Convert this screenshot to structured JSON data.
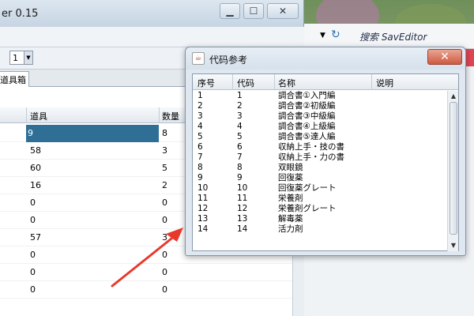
{
  "main_window": {
    "title": "er 0.15",
    "spinner_value": "1",
    "tab_label": "道具箱",
    "columns": [
      "道具",
      "数量"
    ],
    "rows": [
      {
        "item": "9",
        "qty": "8",
        "selected": true
      },
      {
        "item": "58",
        "qty": "3"
      },
      {
        "item": "60",
        "qty": "5"
      },
      {
        "item": "16",
        "qty": "2"
      },
      {
        "item": "0",
        "qty": "0"
      },
      {
        "item": "0",
        "qty": "0"
      },
      {
        "item": "57",
        "qty": "3"
      },
      {
        "item": "0",
        "qty": "0"
      },
      {
        "item": "0",
        "qty": "0"
      },
      {
        "item": "0",
        "qty": "0"
      }
    ]
  },
  "right_app": {
    "search_label": "搜索 SavEditor"
  },
  "dialog": {
    "title": "代码参考",
    "columns": [
      "序号",
      "代码",
      "名称",
      "说明"
    ],
    "rows": [
      {
        "no": "1",
        "code": "1",
        "name": "調合書①入門編",
        "note": ""
      },
      {
        "no": "2",
        "code": "2",
        "name": "調合書②初級編",
        "note": ""
      },
      {
        "no": "3",
        "code": "3",
        "name": "調合書③中級編",
        "note": ""
      },
      {
        "no": "4",
        "code": "4",
        "name": "調合書④上級編",
        "note": ""
      },
      {
        "no": "5",
        "code": "5",
        "name": "調合書⑤達人編",
        "note": ""
      },
      {
        "no": "6",
        "code": "6",
        "name": "収納上手・技の書",
        "note": ""
      },
      {
        "no": "7",
        "code": "7",
        "name": "収納上手・力の書",
        "note": ""
      },
      {
        "no": "8",
        "code": "8",
        "name": "双眼鏡",
        "note": ""
      },
      {
        "no": "9",
        "code": "9",
        "name": "回復薬",
        "note": ""
      },
      {
        "no": "10",
        "code": "10",
        "name": "回復薬グレート",
        "note": ""
      },
      {
        "no": "11",
        "code": "11",
        "name": "栄養剤",
        "note": ""
      },
      {
        "no": "12",
        "code": "12",
        "name": "栄養剤グレート",
        "note": ""
      },
      {
        "no": "13",
        "code": "13",
        "name": "解毒薬",
        "note": ""
      },
      {
        "no": "14",
        "code": "14",
        "name": "活力剤",
        "note": ""
      }
    ]
  },
  "colors": {
    "selection": "#2f6f96",
    "annotation_arrow": "#e8392b",
    "close_button": "#cf5a41"
  }
}
